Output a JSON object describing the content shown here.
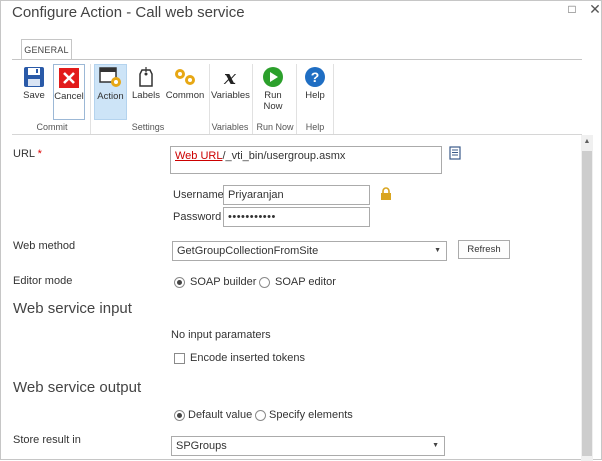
{
  "window": {
    "title": "Configure Action - Call web service",
    "restore_glyph": "□",
    "close_glyph": "✕"
  },
  "ribbon": {
    "tab": "GENERAL",
    "buttons": {
      "save": "Save",
      "cancel": "Cancel",
      "action": "Action",
      "labels": "Labels",
      "common": "Common",
      "variables": "Variables",
      "run_now_1": "Run",
      "run_now_2": "Now",
      "help": "Help"
    },
    "groups": {
      "commit": "Commit",
      "settings": "Settings",
      "variables": "Variables",
      "run_now": "Run Now",
      "help": "Help"
    },
    "icons": [
      "save-icon",
      "cancel-icon",
      "action-icon",
      "labels-icon",
      "common-icon",
      "variables-icon",
      "run-now-icon",
      "help-icon"
    ]
  },
  "form": {
    "url": {
      "label": "URL",
      "required_mark": "*",
      "token": "Web URL",
      "suffix": "/_vti_bin/usergroup.asmx"
    },
    "username": {
      "label": "Username",
      "value": "Priyaranjan"
    },
    "password": {
      "label": "Password",
      "value": "•••••••••••"
    },
    "web_method": {
      "label": "Web method",
      "value": "GetGroupCollectionFromSite",
      "refresh": "Refresh"
    },
    "editor_mode": {
      "label": "Editor mode",
      "options": [
        "SOAP builder",
        "SOAP editor"
      ],
      "selected": "SOAP builder"
    },
    "input_section": {
      "heading": "Web service input",
      "note": "No input paramaters",
      "encode_label": "Encode inserted tokens"
    },
    "output_section": {
      "heading": "Web service output",
      "options": [
        "Default value",
        "Specify elements"
      ],
      "selected": "Default value"
    },
    "store_result": {
      "label": "Store result in",
      "value": "SPGroups"
    }
  },
  "colors": {
    "selected_ribbon": "#cde4f7",
    "token_red": "#cc0000",
    "required_red": "#dd0000",
    "run_green": "#2ca02c",
    "help_blue": "#1f6ec3",
    "save_blue": "#2a5aa8",
    "cancel_red": "#e21b1b",
    "lock_gold": "#d9a520"
  }
}
